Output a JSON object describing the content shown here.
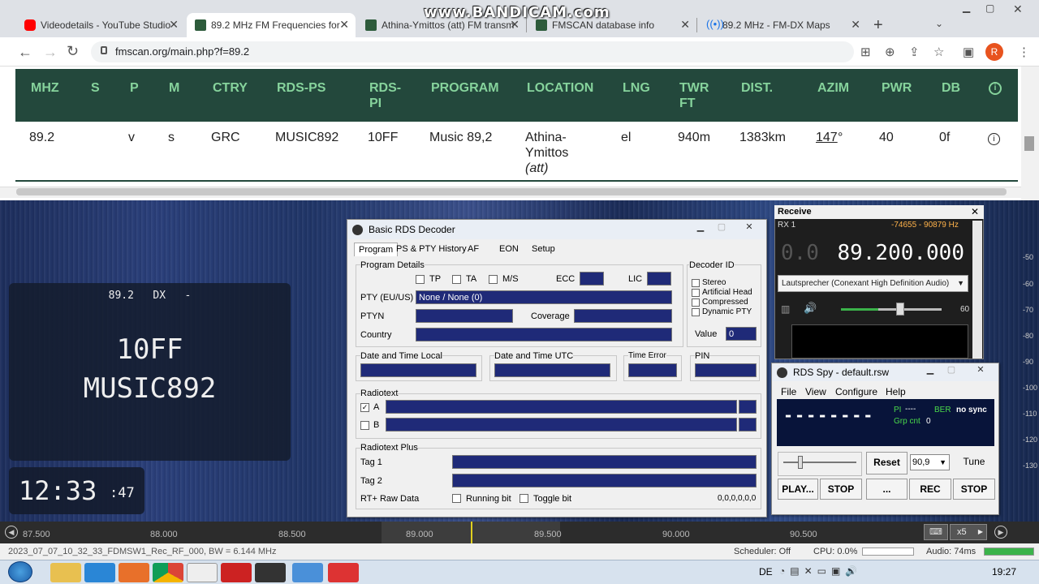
{
  "watermark": "www.BANDICAM.com",
  "browser": {
    "tabs": [
      {
        "title": "Videodetails - YouTube Studio",
        "icon": "youtube-icon",
        "color": "#ff0000"
      },
      {
        "title": "89.2 MHz FM Frequencies for",
        "icon": "fmscan-icon",
        "color": "#2d5b3b"
      },
      {
        "title": "Athina-Ymittos (att) FM transm",
        "icon": "fmscan-icon",
        "color": "#2d5b3b"
      },
      {
        "title": "FMSCAN database info",
        "icon": "fmscan-icon",
        "color": "#2d5b3b"
      },
      {
        "title": "89.2 MHz - FM-DX Maps",
        "icon": "radio-tower-icon",
        "color": "#1a73e8"
      }
    ],
    "url": "fmscan.org/main.php?f=89.2",
    "avatar_letter": "R"
  },
  "fmscan": {
    "headers": [
      "MHZ",
      "S",
      "P",
      "M",
      "CTRY",
      "RDS-PS",
      "RDS-PI",
      "PROGRAM",
      "LOCATION",
      "LNG",
      "TWR FT",
      "DIST.",
      "AZIM",
      "PWR",
      "DB"
    ],
    "row": {
      "mhz": "89.2",
      "s": "",
      "p": "v",
      "m": "s",
      "ctry": "GRC",
      "rds_ps": "MUSIC892",
      "rds_pi": "10FF",
      "program": "Music 89,2",
      "location": "Athina-Ymittos",
      "location_sub": "(att)",
      "lng": "el",
      "twr": "940m",
      "dist": "1383km",
      "azim": "147",
      "azim_unit": "°",
      "pwr": "40",
      "db": "0f"
    }
  },
  "overlay": {
    "top_line": "89.2   DX   -",
    "pi": "10FF",
    "ps": "MUSIC892",
    "clock": "12:33",
    "clock_sec": ":47"
  },
  "rds_decoder": {
    "title": "Basic RDS Decoder",
    "tabs": [
      "Program",
      "PS & PTY History",
      "AF",
      "EON",
      "Setup"
    ],
    "program_details": "Program Details",
    "flags": [
      "TP",
      "TA",
      "M/S"
    ],
    "ecc": "ECC",
    "lic": "LIC",
    "pty_label": "PTY (EU/US)",
    "pty_value": "None / None (0)",
    "ptyn": "PTYN",
    "coverage": "Coverage",
    "country": "Country",
    "decoder_id": "Decoder ID",
    "decoder_flags": [
      "Stereo",
      "Artificial Head",
      "Compressed",
      "Dynamic PTY"
    ],
    "value_label": "Value",
    "value": "0",
    "dt_local": "Date and Time Local",
    "dt_utc": "Date and Time UTC",
    "time_error": "Time Error",
    "pin": "PIN",
    "radiotext": "Radiotext",
    "rt_a": "A",
    "rt_b": "B",
    "rt_plus": "Radiotext Plus",
    "tag1": "Tag 1",
    "tag2": "Tag 2",
    "raw": "RT+ Raw Data",
    "running": "Running bit",
    "toggle": "Toggle bit",
    "raw_value": "0,0,0,0,0,0"
  },
  "receive": {
    "title": "Receive",
    "rx": "RX 1",
    "offset": "-74655 - 90879 Hz",
    "freq_dim": "0.0",
    "freq": "89.200.000",
    "device": "Lautsprecher (Conexant High Definition Audio)",
    "volume": "60"
  },
  "rds_spy": {
    "title": "RDS Spy - default.rsw",
    "menu": [
      "File",
      "View",
      "Configure",
      "Help"
    ],
    "ps_display": "--------",
    "pi_label": "PI",
    "pi_value": "----",
    "ber_label": "BER",
    "ber_value": "no sync",
    "grp_label": "Grp cnt",
    "grp_value": "0",
    "reset": "Reset",
    "freq": "90,9",
    "tune": "Tune",
    "play": "PLAY...",
    "stop1": "STOP",
    "dots": "...",
    "rec": "REC",
    "stop2": "STOP"
  },
  "ruler": {
    "ticks": [
      "87.500",
      "88.000",
      "88.500",
      "89.000",
      "89.500",
      "90.000",
      "90.500"
    ],
    "zoom": "x5"
  },
  "db_scale": [
    "-50",
    "-60",
    "-70",
    "-80",
    "-90",
    "-100",
    "-110",
    "-120",
    "-130"
  ],
  "status": {
    "file": "2023_07_07_10_32_33_FDMSW1_Rec_RF_000, BW = 6.144 MHz",
    "scheduler": "Scheduler: Off",
    "cpu": "CPU: 0.0%",
    "audio": "Audio: 74ms"
  },
  "taskbar": {
    "lang": "DE",
    "time": "19:27"
  }
}
